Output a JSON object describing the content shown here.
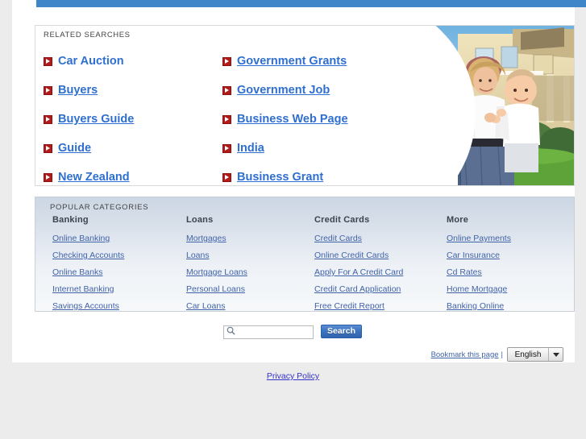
{
  "page": {
    "background_color": "#ececec",
    "content_background": "#ffffff",
    "top_bar_color": "#3f86c8"
  },
  "related": {
    "heading": "RELATED SEARCHES",
    "left_column": [
      {
        "label": "Car Auction",
        "underlined": false
      },
      {
        "label": "Buyers",
        "underlined": true
      },
      {
        "label": "Buyers Guide",
        "underlined": true
      },
      {
        "label": "Guide",
        "underlined": true
      },
      {
        "label": "New Zealand",
        "underlined": true
      }
    ],
    "right_column": [
      {
        "label": "Government Grants",
        "underlined": true
      },
      {
        "label": "Government Job",
        "underlined": true
      },
      {
        "label": "Business Web Page",
        "underlined": true
      },
      {
        "label": "India",
        "underlined": true
      },
      {
        "label": "Business Grant",
        "underlined": true
      }
    ],
    "link_color": "#2f6fd0",
    "bullet_color": "#b01c1c",
    "hero_image_alt": "Family with baby standing in front of a house"
  },
  "categories": {
    "heading": "POPULAR CATEGORIES",
    "columns": [
      {
        "title": "Banking",
        "links": [
          "Online Banking",
          "Checking Accounts",
          "Online Banks",
          "Internet Banking",
          "Savings Accounts"
        ]
      },
      {
        "title": "Loans",
        "links": [
          "Mortgages",
          "Loans",
          "Mortgage Loans",
          "Personal Loans",
          "Car Loans"
        ]
      },
      {
        "title": "Credit Cards",
        "links": [
          "Credit Cards",
          "Online Credit Cards",
          "Apply For A Credit Card",
          "Credit Card Application",
          "Free Credit Report"
        ]
      },
      {
        "title": "More",
        "links": [
          "Online Payments",
          "Car Insurance",
          "Cd Rates",
          "Home Mortgage",
          "Banking Online"
        ]
      }
    ],
    "link_color": "#4163a8"
  },
  "search": {
    "value": "",
    "placeholder": "",
    "button_label": "Search",
    "icon": "search-icon"
  },
  "footer": {
    "bookmark_label": "Bookmark this page",
    "separator": "|",
    "language_value": "English",
    "language_caret": "chevron-down-icon",
    "privacy_label": "Privacy Policy"
  }
}
